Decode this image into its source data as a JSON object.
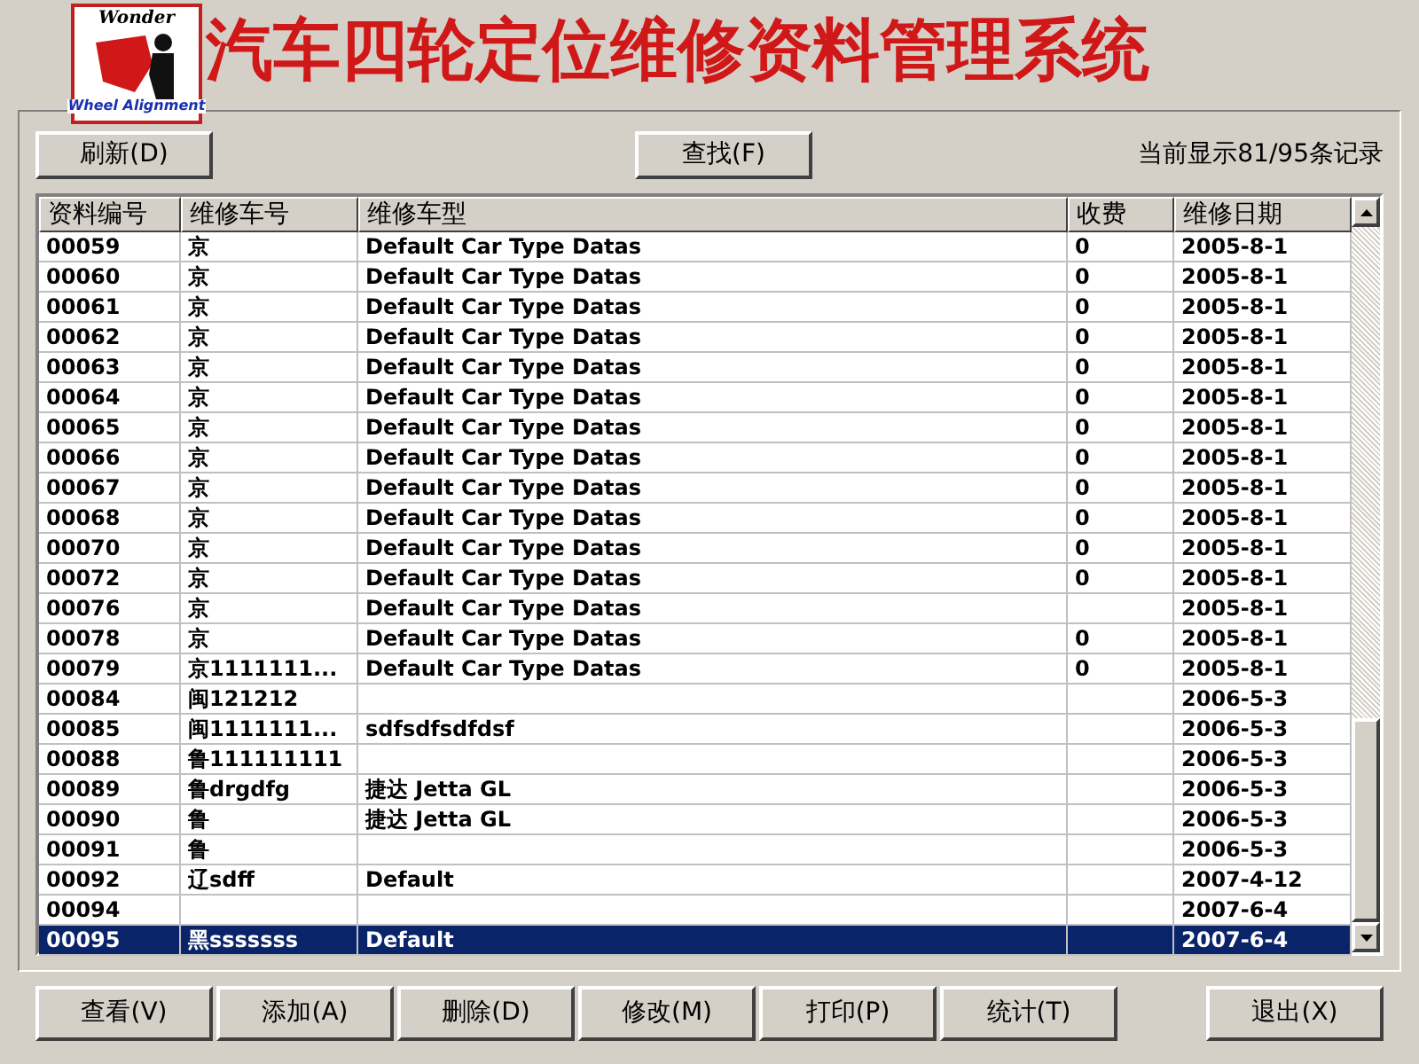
{
  "header": {
    "title": "汽车四轮定位维修资料管理系统",
    "logo": {
      "wordmark": "Wonder",
      "caption": "Wheel Alignment"
    }
  },
  "toolbar": {
    "refresh_button": "刷新(D)",
    "find_button": "查找(F)",
    "record_count": "当前显示81/95条记录"
  },
  "table": {
    "columns": [
      "资料编号",
      "维修车号",
      "维修车型",
      "收费",
      "维修日期"
    ],
    "rows": [
      {
        "cells": [
          "00059",
          "京",
          "Default Car Type Datas",
          "0",
          "2005-8-1"
        ],
        "selected": false
      },
      {
        "cells": [
          "00060",
          "京",
          "Default Car Type Datas",
          "0",
          "2005-8-1"
        ],
        "selected": false
      },
      {
        "cells": [
          "00061",
          "京",
          "Default Car Type Datas",
          "0",
          "2005-8-1"
        ],
        "selected": false
      },
      {
        "cells": [
          "00062",
          "京",
          "Default Car Type Datas",
          "0",
          "2005-8-1"
        ],
        "selected": false
      },
      {
        "cells": [
          "00063",
          "京",
          "Default Car Type Datas",
          "0",
          "2005-8-1"
        ],
        "selected": false
      },
      {
        "cells": [
          "00064",
          "京",
          "Default Car Type Datas",
          "0",
          "2005-8-1"
        ],
        "selected": false
      },
      {
        "cells": [
          "00065",
          "京",
          "Default Car Type Datas",
          "0",
          "2005-8-1"
        ],
        "selected": false
      },
      {
        "cells": [
          "00066",
          "京",
          "Default Car Type Datas",
          "0",
          "2005-8-1"
        ],
        "selected": false
      },
      {
        "cells": [
          "00067",
          "京",
          "Default Car Type Datas",
          "0",
          "2005-8-1"
        ],
        "selected": false
      },
      {
        "cells": [
          "00068",
          "京",
          "Default Car Type Datas",
          "0",
          "2005-8-1"
        ],
        "selected": false
      },
      {
        "cells": [
          "00070",
          "京",
          "Default Car Type Datas",
          "0",
          "2005-8-1"
        ],
        "selected": false
      },
      {
        "cells": [
          "00072",
          "京",
          "Default Car Type Datas",
          "0",
          "2005-8-1"
        ],
        "selected": false
      },
      {
        "cells": [
          "00076",
          "京",
          "Default Car Type Datas",
          "",
          "2005-8-1"
        ],
        "selected": false
      },
      {
        "cells": [
          "00078",
          "京",
          "Default Car Type Datas",
          "0",
          "2005-8-1"
        ],
        "selected": false
      },
      {
        "cells": [
          "00079",
          "京1111111...",
          "Default Car Type Datas",
          "0",
          "2005-8-1"
        ],
        "selected": false
      },
      {
        "cells": [
          "00084",
          "闽121212",
          "",
          "",
          "2006-5-3"
        ],
        "selected": false
      },
      {
        "cells": [
          "00085",
          "闽1111111...",
          "sdfsdfsdfdsf",
          "",
          "2006-5-3"
        ],
        "selected": false
      },
      {
        "cells": [
          "00088",
          "鲁111111111",
          "",
          "",
          "2006-5-3"
        ],
        "selected": false
      },
      {
        "cells": [
          "00089",
          "鲁drgdfg",
          "捷达   Jetta GL",
          "",
          "2006-5-3"
        ],
        "selected": false
      },
      {
        "cells": [
          "00090",
          "鲁",
          "捷达   Jetta GL",
          "",
          "2006-5-3"
        ],
        "selected": false
      },
      {
        "cells": [
          "00091",
          "鲁",
          "",
          "",
          "2006-5-3"
        ],
        "selected": false
      },
      {
        "cells": [
          "00092",
          "辽sdff",
          "Default",
          "",
          "2007-4-12"
        ],
        "selected": false
      },
      {
        "cells": [
          "00094",
          "",
          "",
          "",
          "2007-6-4"
        ],
        "selected": false
      },
      {
        "cells": [
          "00095",
          "黑sssssss",
          "Default",
          "",
          "2007-6-4"
        ],
        "selected": true
      }
    ]
  },
  "actions": [
    {
      "label": "查看(V)",
      "kind": "action"
    },
    {
      "label": "添加(A)",
      "kind": "action"
    },
    {
      "label": "删除(D)",
      "kind": "action"
    },
    {
      "label": "修改(M)",
      "kind": "action"
    },
    {
      "label": "打印(P)",
      "kind": "action"
    },
    {
      "label": "统计(T)",
      "kind": "action"
    },
    {
      "label": "退出(X)",
      "kind": "exit"
    }
  ]
}
